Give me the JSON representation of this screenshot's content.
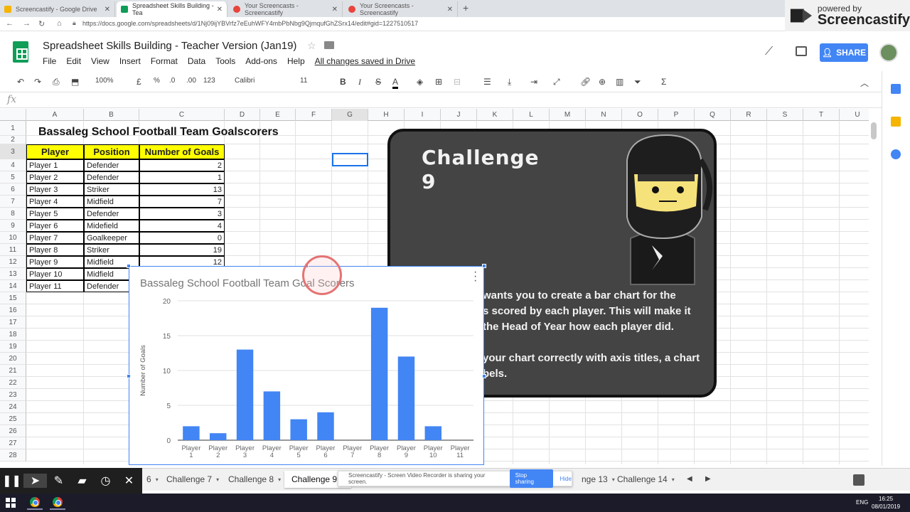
{
  "browser": {
    "tabs": [
      {
        "title": "Screencastify - Google Drive",
        "color": "#f4b400"
      },
      {
        "title": "Spreadsheet Skills Building - Tea",
        "color": "#0f9d58"
      },
      {
        "title": "Your Screencasts - Screencastify",
        "color": "#e8453c"
      },
      {
        "title": "Your Screencasts - Screencastify",
        "color": "#e8453c"
      }
    ],
    "url": "https://docs.google.com/spreadsheets/d/1Nj09ijYBVrfz7eEuhWFY4mbPbNbg9QjmqufGhZSrx14/edit#gid=1227510517"
  },
  "screencastify": {
    "powered_by": "powered by",
    "name": "Screencastify",
    "banner_text": "Screencastify - Screen Video Recorder is sharing your screen.",
    "stop_label": "Stop sharing",
    "hide_label": "Hide"
  },
  "doc": {
    "title": "Spreadsheet Skills Building - Teacher Version (Jan19)",
    "menus": [
      "File",
      "Edit",
      "View",
      "Insert",
      "Format",
      "Data",
      "Tools",
      "Add-ons",
      "Help"
    ],
    "saved_status": "All changes saved in Drive",
    "share_label": "SHARE"
  },
  "toolbar": {
    "zoom": "100%",
    "currency": "£",
    "percent": "%",
    "dec_less": ".0",
    "dec_more": ".00",
    "format": "123",
    "font": "Calibri",
    "font_size": "11"
  },
  "formula_bar": {
    "fx": "fx"
  },
  "grid": {
    "columns": [
      "A",
      "B",
      "C",
      "D",
      "E",
      "F",
      "G",
      "H",
      "I",
      "J",
      "K",
      "L",
      "M",
      "N",
      "O",
      "P",
      "Q",
      "R",
      "S",
      "T",
      "U"
    ],
    "rows": [
      "1",
      "2",
      "3",
      "4",
      "5",
      "6",
      "7",
      "8",
      "9",
      "10",
      "11",
      "12",
      "13",
      "14",
      "15",
      "16",
      "17",
      "18",
      "19",
      "20",
      "21",
      "22",
      "23",
      "24",
      "25",
      "26",
      "27",
      "28"
    ],
    "sheet_title": "Bassaleg School Football Team Goalscorers",
    "headers": [
      "Player",
      "Position",
      "Number of Goals"
    ],
    "data": [
      [
        "Player 1",
        "Defender",
        "2"
      ],
      [
        "Player 2",
        "Defender",
        "1"
      ],
      [
        "Player 3",
        "Striker",
        "13"
      ],
      [
        "Player 4",
        "Midfield",
        "7"
      ],
      [
        "Player 5",
        "Defender",
        "3"
      ],
      [
        "Player 6",
        "Midefield",
        "4"
      ],
      [
        "Player 7",
        "Goalkeeper",
        "0"
      ],
      [
        "Player 8",
        "Striker",
        "19"
      ],
      [
        "Player 9",
        "Midfield",
        "12"
      ],
      [
        "Player 10",
        "Midfield",
        "2"
      ],
      [
        "Player 11",
        "Defender",
        "0"
      ]
    ]
  },
  "challenge": {
    "title_line1": "Challenge",
    "title_line2": "9",
    "lines": [
      "wants you to create a bar chart for the",
      "s scored by each player. This will make it",
      "the Head of Year how each player did.",
      "",
      "your chart correctly with axis titles, a chart",
      "bels."
    ]
  },
  "chart_data": {
    "type": "bar",
    "title": "Bassaleg School Football Team Goal Scorers",
    "ylabel": "Number of Goals",
    "xlabel": "",
    "categories": [
      [
        "Player",
        "1"
      ],
      [
        "Player",
        "2"
      ],
      [
        "Player",
        "3"
      ],
      [
        "Player",
        "4"
      ],
      [
        "Player",
        "5"
      ],
      [
        "Player",
        "6"
      ],
      [
        "Player",
        "7"
      ],
      [
        "Player",
        "8"
      ],
      [
        "Player",
        "9"
      ],
      [
        "Player",
        "10"
      ],
      [
        "Player",
        "11"
      ]
    ],
    "values": [
      2,
      1,
      13,
      7,
      3,
      4,
      0,
      19,
      12,
      2,
      0
    ],
    "ylim": [
      0,
      20
    ],
    "yticks": [
      "0",
      "5",
      "10",
      "15",
      "20"
    ],
    "color": "#4285f4",
    "grid": true,
    "legend": "none"
  },
  "sheet_tabs": [
    "6",
    "Challenge 7",
    "Challenge 8",
    "Challenge 9",
    "nge 13",
    "Challenge 14"
  ],
  "taskbar": {
    "time": "16:25",
    "date": "08/01/2019",
    "lang": "ENG"
  }
}
